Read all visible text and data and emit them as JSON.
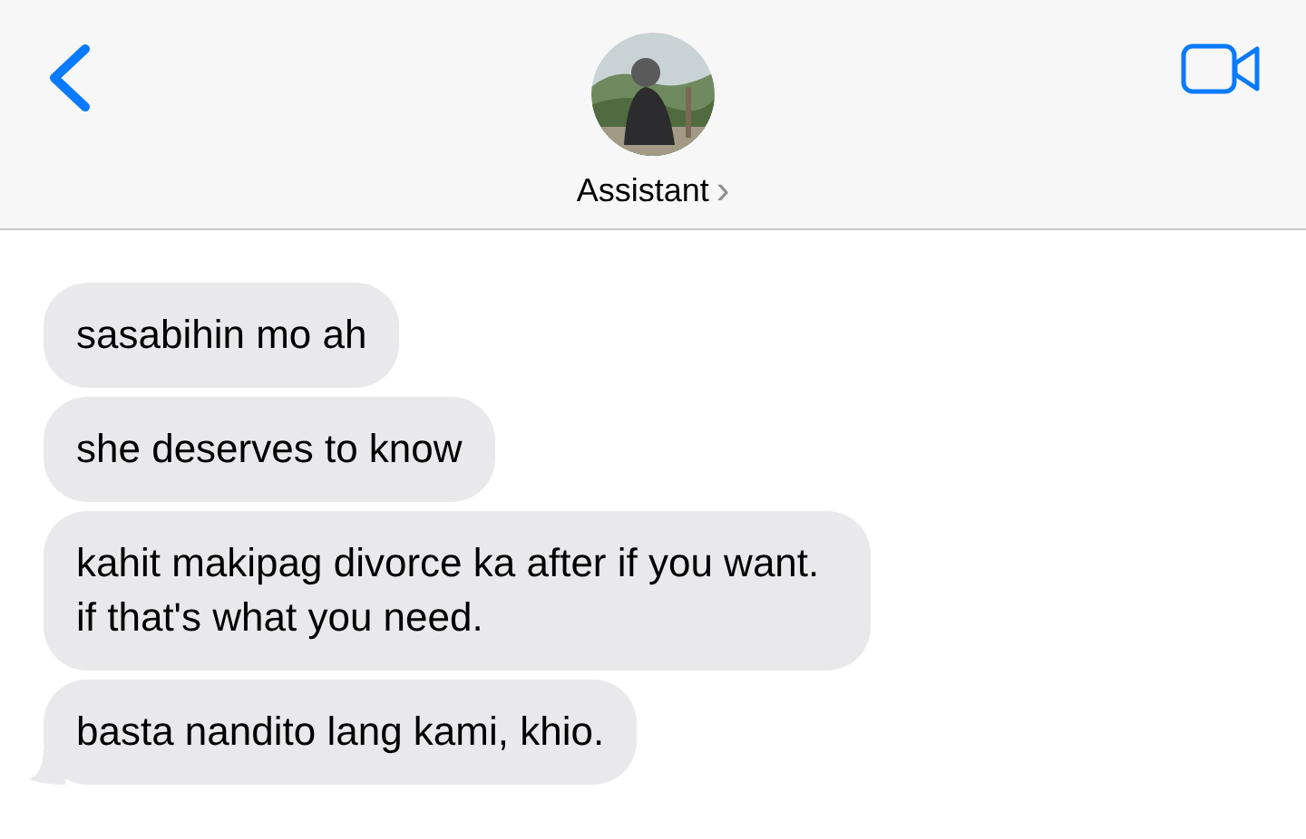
{
  "header": {
    "contact_name": "Assistant",
    "chevron": "›"
  },
  "messages": [
    {
      "text": "sasabihin mo ah",
      "tail": false
    },
    {
      "text": "she deserves to know",
      "tail": false
    },
    {
      "text": "kahit makipag divorce ka after if you want. if that's what you need.",
      "tail": false
    },
    {
      "text": "basta nandito lang kami, khio.",
      "tail": true
    }
  ]
}
